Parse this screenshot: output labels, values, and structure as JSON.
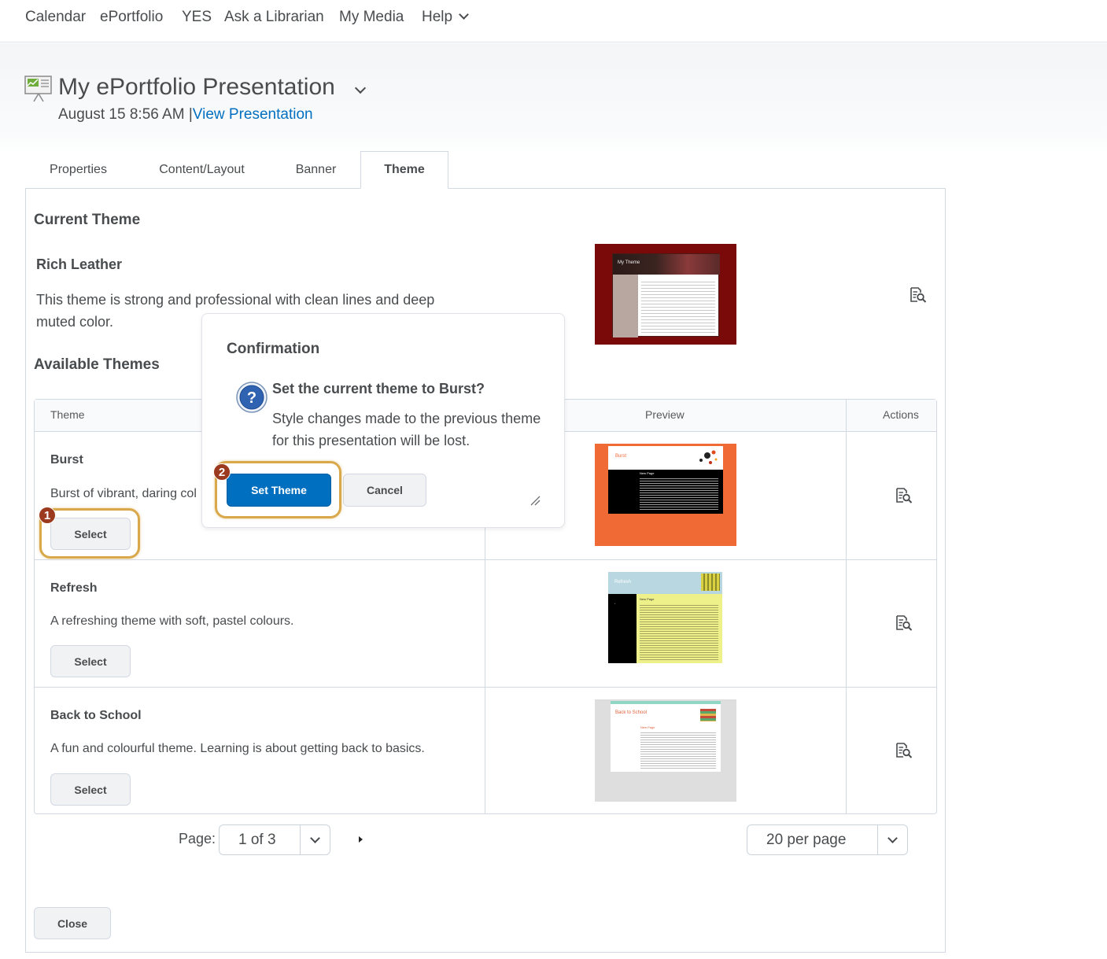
{
  "nav": {
    "items": [
      "Calendar",
      "ePortfolio",
      "YES",
      "Ask a Librarian",
      "My Media",
      "Help"
    ]
  },
  "header": {
    "title": "My ePortfolio Presentation",
    "date": "August 15 8:56 AM |",
    "view_link": "View Presentation"
  },
  "tabs": [
    "Properties",
    "Content/Layout",
    "Banner",
    "Theme"
  ],
  "current_theme": {
    "heading": "Current Theme",
    "name": "Rich Leather",
    "description_line1": "This theme is strong and professional with clean lines and deep",
    "description_line2": "muted color."
  },
  "available": {
    "heading": "Available Themes",
    "columns": [
      "Theme",
      "Preview",
      "Actions"
    ],
    "rows": [
      {
        "name": "Burst",
        "description": "Burst of vibrant, daring col",
        "button": "Select"
      },
      {
        "name": "Refresh",
        "description": "A refreshing theme with soft, pastel colours.",
        "button": "Select"
      },
      {
        "name": "Back to School",
        "description": "A fun and colourful theme. Learning is about getting back to basics.",
        "button": "Select"
      }
    ]
  },
  "thumbs": {
    "rich_leather_title": "My Theme",
    "burst_title": "Burst",
    "burst_page": "New Page",
    "refresh_title": "Refresh",
    "refresh_page": "New Page",
    "school_title": "Back to School",
    "school_page": "New Page"
  },
  "paging": {
    "label": "Page:",
    "page_value": "1 of 3",
    "per_page": "20 per page"
  },
  "close_button": "Close",
  "dialog": {
    "title": "Confirmation",
    "question": "Set the current theme to Burst?",
    "message": "Style changes made to the previous theme for this presentation will be lost.",
    "confirm": "Set Theme",
    "cancel": "Cancel"
  },
  "callouts": [
    "1",
    "2"
  ],
  "colors": {
    "link": "#006fbf",
    "primary_button": "#006fbf",
    "callout_ring": "#d8a84a",
    "callout_badge": "#9b3a1f"
  }
}
